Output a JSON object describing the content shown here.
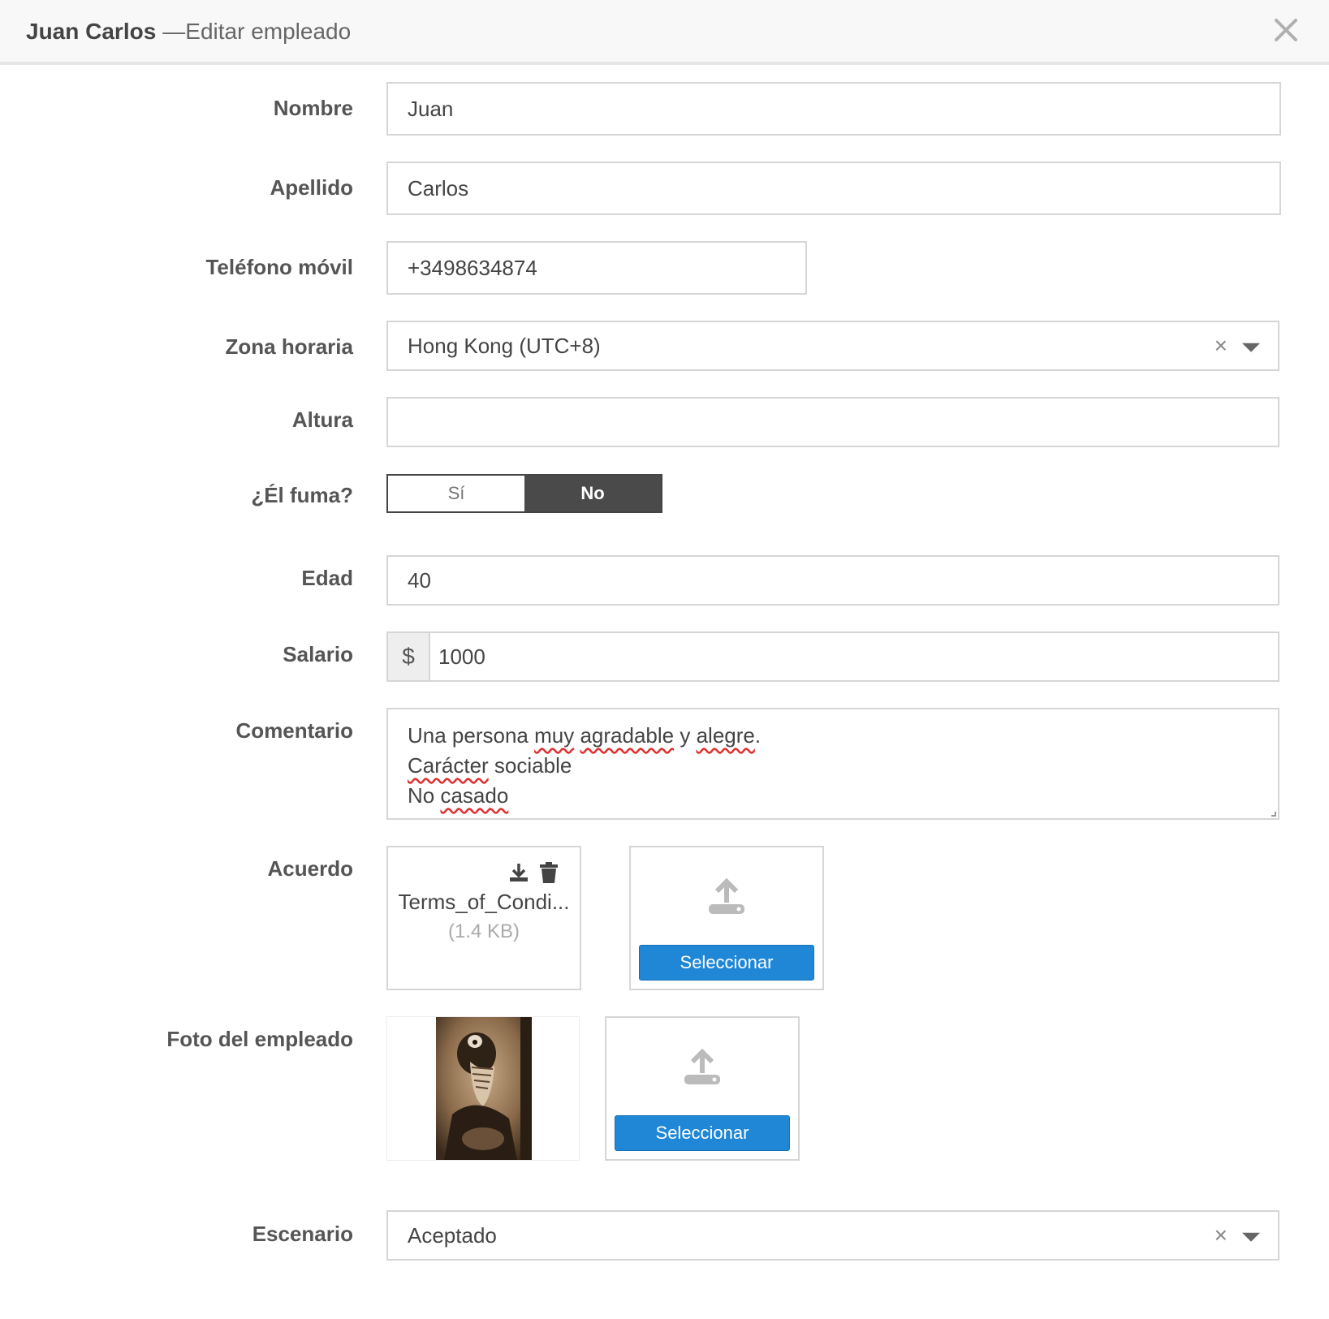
{
  "header": {
    "name": "Juan Carlos",
    "subtitle": "—Editar empleado"
  },
  "form": {
    "nombre": {
      "label": "Nombre",
      "value": "Juan"
    },
    "apellido": {
      "label": "Apellido",
      "value": "Carlos"
    },
    "telefono": {
      "label": "Teléfono móvil",
      "value": "+3498634874"
    },
    "zona": {
      "label": "Zona horaria",
      "value": "Hong Kong (UTC+8)"
    },
    "altura": {
      "label": "Altura",
      "value": ""
    },
    "fuma": {
      "label": "¿Él fuma?",
      "option_yes": "Sí",
      "option_no": "No",
      "selected": "No"
    },
    "edad": {
      "label": "Edad",
      "value": "40"
    },
    "salario": {
      "label": "Salario",
      "currency": "$",
      "value": "1000"
    },
    "comentario": {
      "label": "Comentario",
      "line1_a": "Una persona ",
      "line1_b": "muy",
      "line1_c": " ",
      "line1_d": "agradable",
      "line1_e": " y ",
      "line1_f": "alegre",
      "line1_g": ".",
      "line2_a": "Carácter",
      "line2_b": " sociable",
      "line3_a": "No ",
      "line3_b": "casado"
    },
    "acuerdo": {
      "label": "Acuerdo",
      "file_name": "Terms_of_Condi...",
      "file_size": "(1.4 KB)",
      "select_label": "Seleccionar"
    },
    "foto": {
      "label": "Foto del empleado",
      "select_label": "Seleccionar"
    },
    "escenario": {
      "label": "Escenario",
      "value": "Aceptado"
    }
  },
  "icons": {
    "close": "close-icon",
    "download": "download-icon",
    "trash": "trash-icon",
    "upload": "upload-icon",
    "clear": "×"
  },
  "colors": {
    "accent": "#1f87d6",
    "toggle_on": "#4a4a4a"
  }
}
